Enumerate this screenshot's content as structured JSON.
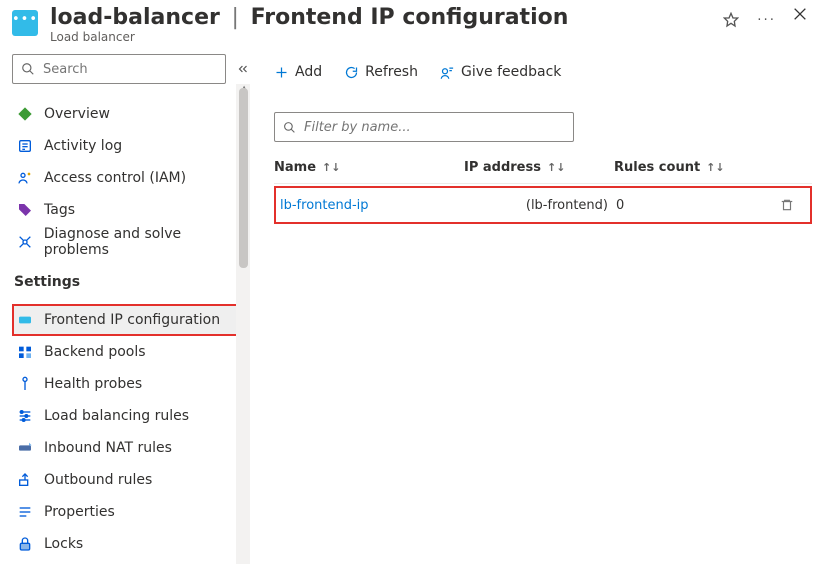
{
  "header": {
    "resource_name": "load-balancer",
    "page_title": "Frontend IP configuration",
    "resource_type": "Load balancer"
  },
  "sidebar": {
    "search_placeholder": "Search",
    "items": [
      {
        "label": "Overview",
        "icon": "overview-icon"
      },
      {
        "label": "Activity log",
        "icon": "activity-log-icon"
      },
      {
        "label": "Access control (IAM)",
        "icon": "access-control-icon"
      },
      {
        "label": "Tags",
        "icon": "tags-icon"
      },
      {
        "label": "Diagnose and solve problems",
        "icon": "diagnose-icon"
      }
    ],
    "group_label": "Settings",
    "settings": [
      {
        "label": "Frontend IP configuration",
        "icon": "frontend-ip-icon",
        "selected": true
      },
      {
        "label": "Backend pools",
        "icon": "backend-pools-icon"
      },
      {
        "label": "Health probes",
        "icon": "health-probes-icon"
      },
      {
        "label": "Load balancing rules",
        "icon": "lb-rules-icon"
      },
      {
        "label": "Inbound NAT rules",
        "icon": "inbound-nat-icon"
      },
      {
        "label": "Outbound rules",
        "icon": "outbound-rules-icon"
      },
      {
        "label": "Properties",
        "icon": "properties-icon"
      },
      {
        "label": "Locks",
        "icon": "locks-icon"
      }
    ]
  },
  "toolbar": {
    "add_label": "Add",
    "refresh_label": "Refresh",
    "feedback_label": "Give feedback"
  },
  "grid": {
    "filter_placeholder": "Filter by name...",
    "columns": {
      "name": "Name",
      "ip": "IP address",
      "rules": "Rules count"
    },
    "rows": [
      {
        "name": "lb-frontend-ip",
        "ip": "(lb-frontend)",
        "rules": "0"
      }
    ]
  }
}
